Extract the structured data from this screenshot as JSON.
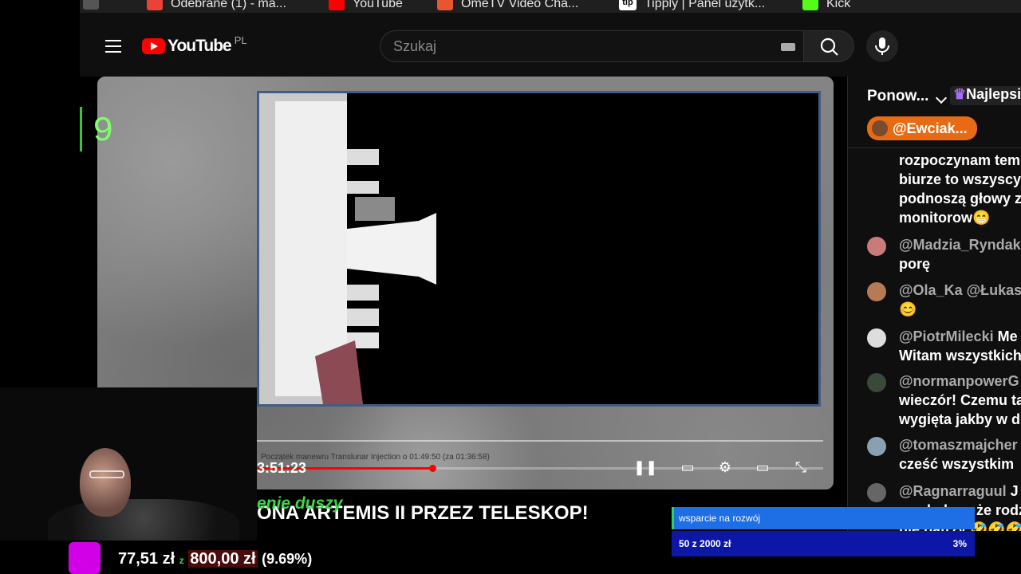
{
  "bookmarks": [
    {
      "label": "Odebrane (1) - ma...",
      "icon": "gmail-icon",
      "color": "#ea4335"
    },
    {
      "label": "YouTube",
      "icon": "youtube-icon",
      "color": "#ff0000"
    },
    {
      "label": "OmeTV Video Cha...",
      "icon": "ometv-icon",
      "color": "#e8552f"
    },
    {
      "label": "Tipply | Panel użytk...",
      "icon": "tipply-icon",
      "color": "#222222"
    },
    {
      "label": "Kick",
      "icon": "kick-icon",
      "color": "#53fc18"
    }
  ],
  "header": {
    "logo_text": "YouTube",
    "country_code": "PL",
    "search_placeholder": "Szukaj"
  },
  "overlay": {
    "counter": "9",
    "green_text": "enie duszy"
  },
  "video": {
    "time": "3:51:23",
    "caption_line": "Początek manewru Translunar Injection o 01:49:50 (za 01:36:58)",
    "progress_fraction": 0.31,
    "title": "ONA ARTEMIS II PRZEZ TELESKOP!",
    "accent_color": "#ff0000"
  },
  "chat": {
    "mode_label": "Ponow...",
    "top_label": "Najlepsi",
    "pinned_user": "@Ewciak...",
    "messages": [
      {
        "author": "",
        "lines": [
          "rozpoczynam tem",
          "biurze to wszyscy",
          "podnoszą głowy z",
          "monitorow😁"
        ],
        "avatar_color": "#000000"
      },
      {
        "author": "@Madzia_Ryndak",
        "lines": [
          "porę"
        ],
        "avatar_color": "#c97b7b"
      },
      {
        "author": "@Ola_Ka",
        "extra": "@Łukas",
        "lines": [
          "😊"
        ],
        "avatar_color": "#b77a57"
      },
      {
        "author": "@PiotrMilecki",
        "extra": "Me",
        "lines": [
          "Witam wszystkich"
        ],
        "avatar_color": "#dddddd"
      },
      {
        "author": "@normanpowerG",
        "lines": [
          "wieczór! Czemu ta",
          "wygięta jakby w d"
        ],
        "avatar_color": "#3a4a3a"
      },
      {
        "author": "@tomaszmajcher",
        "lines": [
          "cześć wszystkim"
        ],
        "avatar_color": "#8aa0b0"
      },
      {
        "author": "@Ragnarraguul",
        "extra": "J",
        "lines": [
          "wyglądam, że rodz",
          "nie patrzy 🤣🤣🤣"
        ],
        "avatar_color": "#666666"
      }
    ]
  },
  "donation": {
    "current": "77,51 zł",
    "separator": "z",
    "goal": "800,00 zł",
    "percent": "(9.69%)"
  },
  "goal_widget": {
    "label": "wsparcie na rozwój",
    "progress_text": "50 z 2000 zł",
    "percent": "3%"
  }
}
